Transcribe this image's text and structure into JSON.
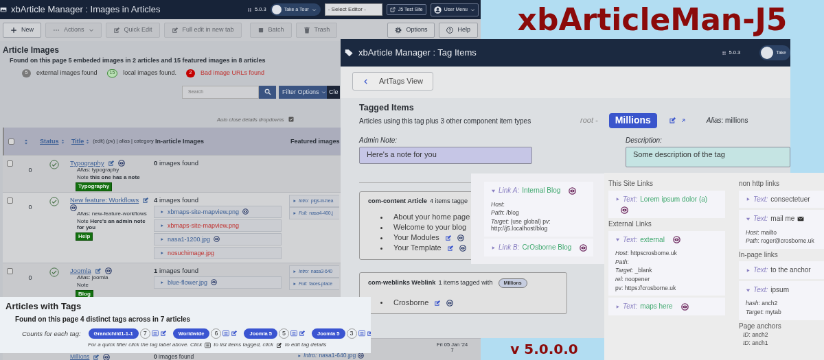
{
  "banner": {
    "title": "xbArticleMan-J5",
    "version": "v 5.0.0.0"
  },
  "images_window": {
    "title": "xbArticle Manager : Images in Articles",
    "version": "5.0.3",
    "tour": "Take a Tour",
    "editor": "- Select Editor -",
    "site": "J5 Test Site",
    "user": "User Menu",
    "toolbar": [
      {
        "label": "New",
        "disabled": false
      },
      {
        "label": "Actions",
        "disabled": true
      },
      {
        "label": "Quick Edit",
        "disabled": true
      },
      {
        "label": "Full edit in new tab",
        "disabled": true
      },
      {
        "label": "Batch",
        "disabled": true
      },
      {
        "label": "Trash",
        "disabled": true
      }
    ],
    "toolbar_right": [
      "Options",
      "Help"
    ],
    "heading": "Article Images",
    "summary": "Found on this page 5 embeded images in 2 articles and 15 featured images in 8 articles",
    "counts": [
      {
        "count": "5",
        "label": "external images found",
        "kind": "external"
      },
      {
        "count": "15",
        "label": "local images found.",
        "kind": "local"
      },
      {
        "count": "2",
        "label": "Bad image URLs found",
        "kind": "bad"
      }
    ],
    "search": {
      "placeholder": "Search"
    },
    "filter_button": "Filter Options",
    "clear_button": "Cle",
    "auto_close": {
      "label": "Auto close details dropdowns",
      "checked": true
    },
    "select_all": false,
    "columns": [
      {
        "label": "Status",
        "sortable": true
      },
      {
        "label": "Title",
        "sortable": true,
        "suffix": "(edit) (pv) | alias | category"
      },
      {
        "label": "In-article Images",
        "sortable": false
      },
      {
        "label": "Featured images",
        "sortable": false
      }
    ],
    "rows": [
      {
        "selected": false,
        "order": "0",
        "published": true,
        "title": "Typography",
        "alias": "*Alias*: typography",
        "note": "Note **this one has a note**",
        "category": "Typography",
        "images_count": "**0** images found",
        "images": [],
        "featured": []
      },
      {
        "selected": false,
        "order": "0",
        "published": true,
        "title": "New feature: Workflows",
        "alias": "*Alias*: new-feature-workflows",
        "note": "Note **Here's an admin note for you**",
        "category": "Help",
        "images_count": "**4** images found",
        "images": [
          {
            "name": "xbmaps-site-mapview.png",
            "bad": false
          },
          {
            "name": "xbmaps-site-mapview.png",
            "bad": true
          },
          {
            "name": "nasa1-1200.jpg",
            "bad": false
          },
          {
            "name": "nosuchimage.jpg",
            "bad": true
          }
        ],
        "featured": [
          {
            "label": "Intro:",
            "file": "pigs-in-hea"
          },
          {
            "label": "Full:",
            "file": "nasa4-400.j"
          }
        ]
      },
      {
        "selected": false,
        "order": "0",
        "published": true,
        "title": "Joomla",
        "alias": "*Alias*: joomla",
        "note": "Note",
        "category": "Blog",
        "images_count": "**1** images found",
        "images": [
          {
            "name": "blue-flower.jpg",
            "bad": false
          }
        ],
        "featured": [
          {
            "label": "Intro:",
            "file": "nasa3-640"
          },
          {
            "label": "Full:",
            "file": "faces-place"
          }
        ]
      },
      {
        "title": "Millions",
        "images_count": "**0** images found",
        "featured": [
          {
            "label": "Intro:",
            "file": "nasa1-640.jpg"
          }
        ],
        "date": "Fri 05 Jan '24",
        "hits": "7"
      }
    ]
  },
  "tag_window": {
    "title": "xbArticle Manager : Tag Items",
    "version": "5.0.3",
    "tour": "Take",
    "back_button": "ArtTags View",
    "heading": "Tagged Items",
    "subtitle": "Articles using this tag plus 3 other component item types",
    "parent": "root -",
    "tag": "Millions",
    "alias": "*Alias*: millions",
    "admin_note": {
      "label": "Admin Note:",
      "value": "Here's a note for you"
    },
    "description": {
      "label": "Description:",
      "value": "Some description of the tag"
    },
    "groups": [
      {
        "component": "com-content Article",
        "count": "4 items tagge",
        "items": [
          "About your home page",
          "Welcome to your blog",
          "Your Modules",
          "Your Template"
        ]
      },
      {
        "component": "com-weblinks Weblink",
        "count": "1 items tagged with",
        "tag": "Millions",
        "items": [
          "Crosborne"
        ]
      }
    ]
  },
  "links_panel": {
    "internal": [
      {
        "prefix": "Link A:",
        "text": "Internal Blog",
        "kind": "site",
        "expanded": true,
        "preview": true,
        "details": [
          "*Host*:",
          "*Path*: /blog",
          "*Target*: (use global) pv: http://j5.localhost/blog"
        ]
      },
      {
        "prefix": "Link B:",
        "text": "CrOsborne Blog",
        "kind": "site",
        "expanded": false,
        "preview": true
      }
    ],
    "columns": [
      [
        {
          "heading": "This Site Links",
          "links": [
            {
              "prefix": "Text:",
              "text": "Lorem ipsum dolor (a)",
              "kind": "site",
              "expanded": false,
              "preview": true
            }
          ]
        },
        {
          "heading": "External Links",
          "links": [
            {
              "prefix": "Text:",
              "text": "external",
              "kind": "site",
              "expanded": true,
              "preview": true,
              "details": [
                "*Host*: httpscrosborne.uk",
                "*Path*:",
                "*Target*: _blank",
                "*rel*: noopener",
                "pv: https://crosborne.uk"
              ]
            },
            {
              "prefix": "Text:",
              "text": "maps here",
              "kind": "site",
              "expanded": false,
              "preview": true
            }
          ]
        }
      ],
      [
        {
          "heading": "non http links",
          "links": [
            {
              "prefix": "Text:",
              "text": "consectetuer",
              "kind": "other",
              "expanded": false,
              "preview": false
            },
            {
              "prefix": "Text:",
              "text": "mail me",
              "kind": "mail",
              "expanded": true,
              "preview": false,
              "details": [
                "*Host*: mailto",
                "*Path*: roger@crosborne.uk"
              ]
            }
          ]
        },
        {
          "heading": "In-page links",
          "links": [
            {
              "prefix": "Text:",
              "text": "to the anchor",
              "kind": "other",
              "expanded": false,
              "preview": false
            },
            {
              "prefix": "Text:",
              "text": "ipsum",
              "kind": "other",
              "expanded": true,
              "preview": false,
              "details": [
                "*hash*: anch2",
                "*Target*: mytab"
              ]
            }
          ]
        },
        {
          "heading": "Page anchors",
          "anchors": [
            "*ID*: anch2",
            "*ID*: anch1"
          ]
        }
      ]
    ]
  },
  "tags_panel": {
    "title": "Articles with Tags",
    "summary": "Found on this page 4 distinct tags across in 7 articles",
    "counts_label": "Counts for each tag:",
    "tags": [
      {
        "name": "Grandchild1-1-1",
        "count": "7"
      },
      {
        "name": "Worldwide",
        "count": "6"
      },
      {
        "name": "Joomla 5",
        "count": "5"
      },
      {
        "name": "Joomla 5",
        "count": "3"
      }
    ],
    "hint": [
      "For a quick filter click the tag label above. Click",
      "to list items tagged, click",
      "to edit tag details"
    ]
  }
}
